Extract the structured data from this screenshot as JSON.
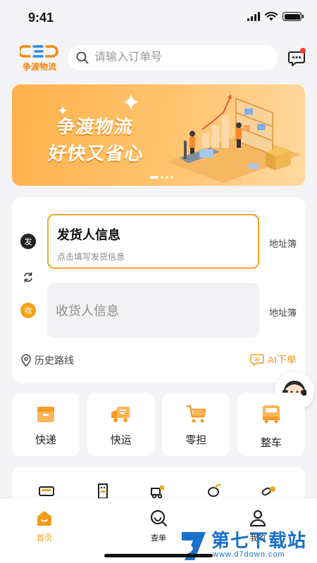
{
  "status_bar": {
    "time": "9:41"
  },
  "header": {
    "logo_text": "争渡物流",
    "search_placeholder": "请输入订单号"
  },
  "banner": {
    "title_line1": "争渡物流",
    "title_line2": "好快又省心",
    "dots": 4,
    "active_dot": 0
  },
  "order": {
    "send_tag": "发",
    "recv_tag": "收",
    "sender_title": "发货人信息",
    "sender_hint": "点击填写发货信息",
    "receiver_title": "收货人信息",
    "address_book": "地址簿",
    "history_label": "历史路线",
    "ai_order_label": "AI下单",
    "ai_badge": "AI"
  },
  "services": [
    {
      "label": "快递",
      "icon": "box-icon"
    },
    {
      "label": "快运",
      "icon": "truck-icon"
    },
    {
      "label": "零担",
      "icon": "cart-icon"
    },
    {
      "label": "整车",
      "icon": "van-icon"
    }
  ],
  "tabbar": {
    "home": "首页",
    "query": "查单",
    "mine": "我的"
  },
  "watermark": {
    "main": "第七下载站",
    "sub": "www.d7down.com"
  },
  "colors": {
    "accent": "#f59a16",
    "banner": "#ffb14c",
    "background": "#f4f4f6"
  }
}
